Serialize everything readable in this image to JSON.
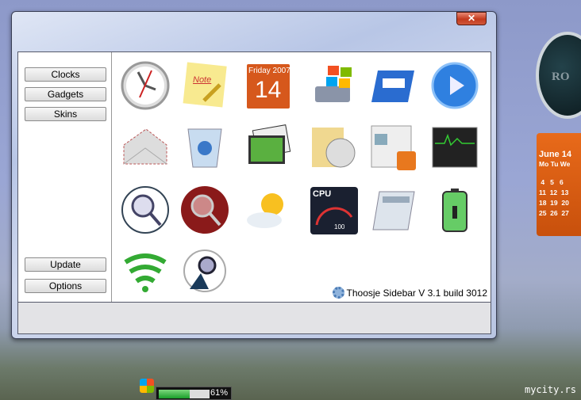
{
  "window": {
    "close_label": "✕"
  },
  "sidebar": {
    "buttons": [
      "Clocks",
      "Gadgets",
      "Skins"
    ],
    "bottom_buttons": [
      "Update",
      "Options"
    ]
  },
  "gadgets": [
    {
      "name": "analog-clock"
    },
    {
      "name": "notes",
      "text": "Note"
    },
    {
      "name": "calendar",
      "day": "Friday 2007",
      "date": "14"
    },
    {
      "name": "windows-drive"
    },
    {
      "name": "window-switcher"
    },
    {
      "name": "media-player"
    },
    {
      "name": "mail"
    },
    {
      "name": "recycle-bin"
    },
    {
      "name": "slideshow"
    },
    {
      "name": "folder-clock"
    },
    {
      "name": "rss-news"
    },
    {
      "name": "system-monitor"
    },
    {
      "name": "search"
    },
    {
      "name": "search-red"
    },
    {
      "name": "weather"
    },
    {
      "name": "cpu-meter",
      "label": "CPU",
      "value": "100"
    },
    {
      "name": "calculator"
    },
    {
      "name": "battery"
    },
    {
      "name": "wifi"
    },
    {
      "name": "xfire"
    }
  ],
  "status": "Thoosje Sidebar V 3.1  build 3012",
  "desktop": {
    "clock_text": "RO",
    "calendar": {
      "title": "June 14",
      "header": "Mo Tu We",
      "rows": [
        " 4   5   6",
        "11  12  13",
        "18  19  20",
        "25  26  27"
      ]
    },
    "tray_percent": "61%",
    "tray_progress": 0.61,
    "watermark": "mycity.rs"
  }
}
